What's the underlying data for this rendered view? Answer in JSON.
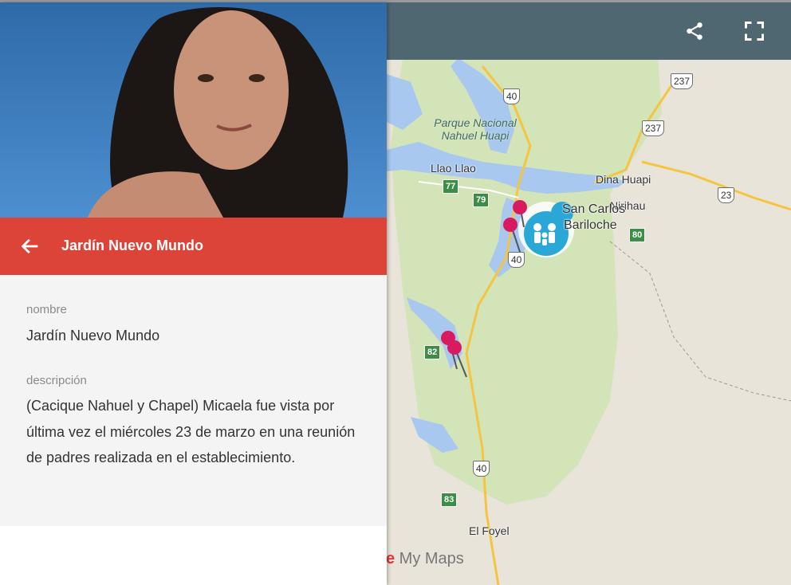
{
  "panel": {
    "title": "Jardín Nuevo Mundo",
    "fields": [
      {
        "label": "nombre",
        "value": "Jardín Nuevo Mundo"
      },
      {
        "label": "descripción",
        "value": "(Cacique Nahuel y Chapel) Micaela fue vista por última vez el miércoles 23 de marzo en una reunión de padres realizada en el  establecimiento."
      }
    ]
  },
  "toolbar": {
    "share_icon": "share-icon",
    "fullscreen_icon": "fullscreen-icon"
  },
  "map": {
    "park_label": "Parque Nacional Nahuel Huapi",
    "places": {
      "llao_llao": "Llao Llao",
      "dina_huapi": "Dina Huapi",
      "nirihau": "Nirihau",
      "city_line1": "San Carlos",
      "city_line2": "Bariloche",
      "el_foyel": "El Foyel"
    },
    "routes": {
      "r40a": "40",
      "r40b": "40",
      "r40c": "40",
      "r237a": "237",
      "r237b": "237",
      "r23": "23",
      "r77": "77",
      "r79": "79",
      "r80": "80",
      "r82": "82",
      "r83": "83"
    },
    "brand": {
      "g": "e",
      "rest": " My Maps"
    },
    "colors": {
      "water": "#a8c8f0",
      "park": "#cfe3b4",
      "land": "#e9e4da",
      "highlight": "#db4437",
      "toolbar": "#4f6771",
      "pin": "#d81b60",
      "marker": "#29a8d8"
    }
  }
}
